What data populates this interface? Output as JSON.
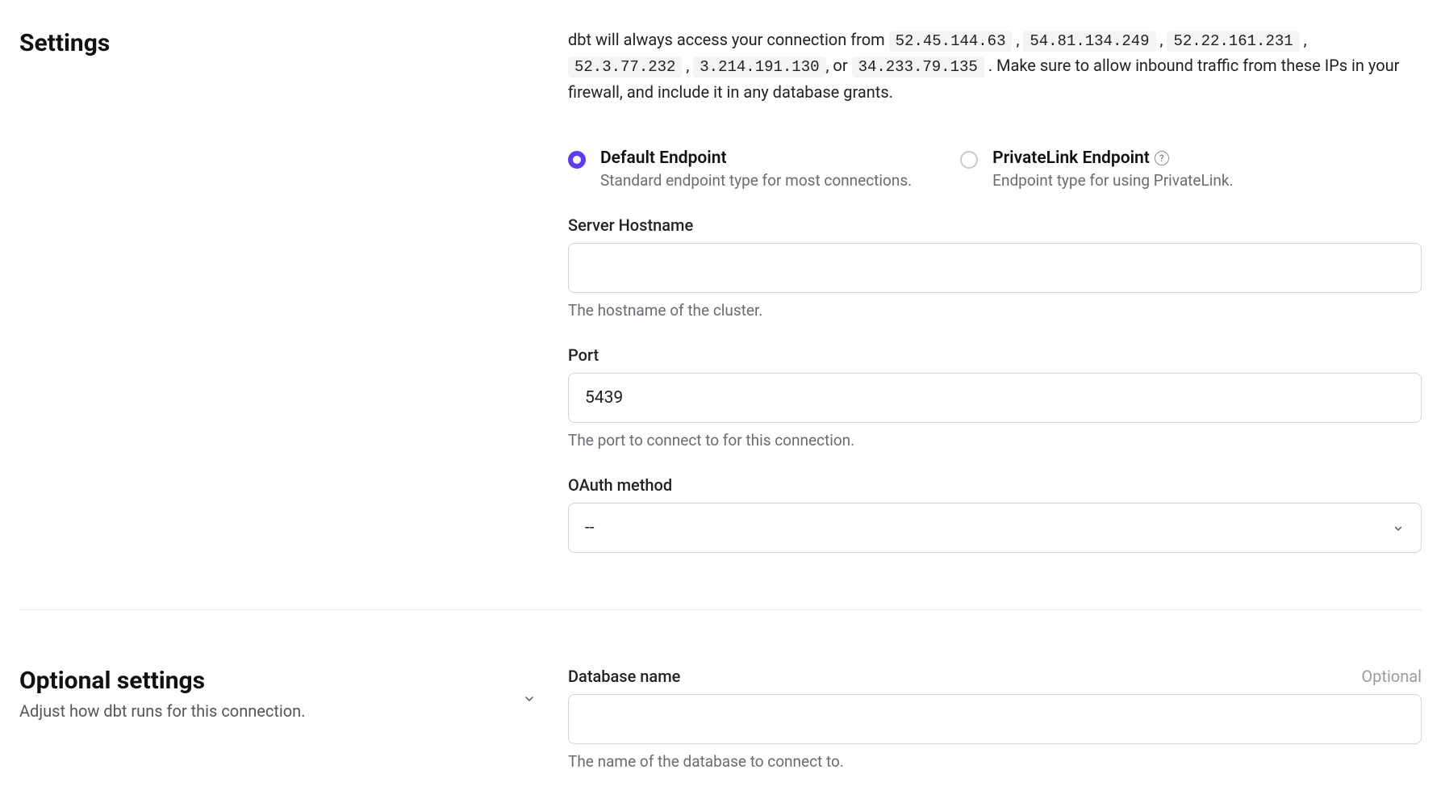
{
  "settings": {
    "title": "Settings",
    "intro_prefix": "dbt will always access your connection from ",
    "ips": [
      "52.45.144.63",
      "54.81.134.249",
      "52.22.161.231",
      "52.3.77.232",
      "3.214.191.130",
      "34.233.79.135"
    ],
    "intro_or": ", or ",
    "intro_comma": " , ",
    "intro_suffix": " . Make sure to allow inbound traffic from these IPs in your firewall, and include it in any database grants."
  },
  "endpoints": {
    "default": {
      "label": "Default Endpoint",
      "desc": "Standard endpoint type for most connections."
    },
    "privatelink": {
      "label": "PrivateLink Endpoint",
      "desc": "Endpoint type for using PrivateLink."
    }
  },
  "fields": {
    "hostname": {
      "label": "Server Hostname",
      "value": "",
      "help": "The hostname of the cluster."
    },
    "port": {
      "label": "Port",
      "value": "5439",
      "help": "The port to connect to for this connection."
    },
    "oauth": {
      "label": "OAuth method",
      "value": "--"
    },
    "dbname": {
      "label": "Database name",
      "optional": "Optional",
      "value": "",
      "help": "The name of the database to connect to."
    }
  },
  "optional_section": {
    "title": "Optional settings",
    "subtitle": "Adjust how dbt runs for this connection."
  }
}
